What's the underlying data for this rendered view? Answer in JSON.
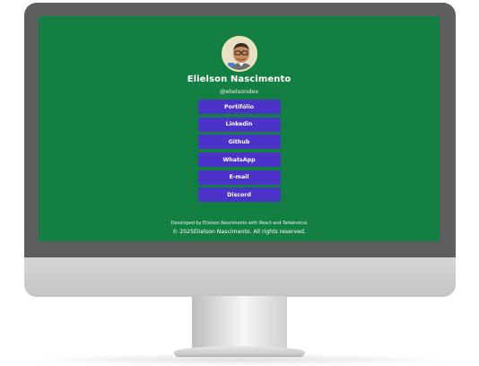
{
  "profile": {
    "name": "Elielson Nascimento",
    "handle": "@elielsondev"
  },
  "links": [
    {
      "label": "Portifólio",
      "name": "portfolio-button"
    },
    {
      "label": "Linkedin",
      "name": "linkedin-button"
    },
    {
      "label": "Github",
      "name": "github-button"
    },
    {
      "label": "WhatsApp",
      "name": "whatsapp-button"
    },
    {
      "label": "E-mail",
      "name": "email-button"
    },
    {
      "label": "Discord",
      "name": "discord-button"
    }
  ],
  "footer": {
    "developed_by": "Developed by Elielson Nascimento with React and Tailwindcss",
    "copyright": "© 2025Elielson Nascimento. All rights reserved."
  },
  "colors": {
    "screen_bg": "#147f42",
    "button_bg": "#4b33c9",
    "bezel": "#5e5e5e"
  }
}
